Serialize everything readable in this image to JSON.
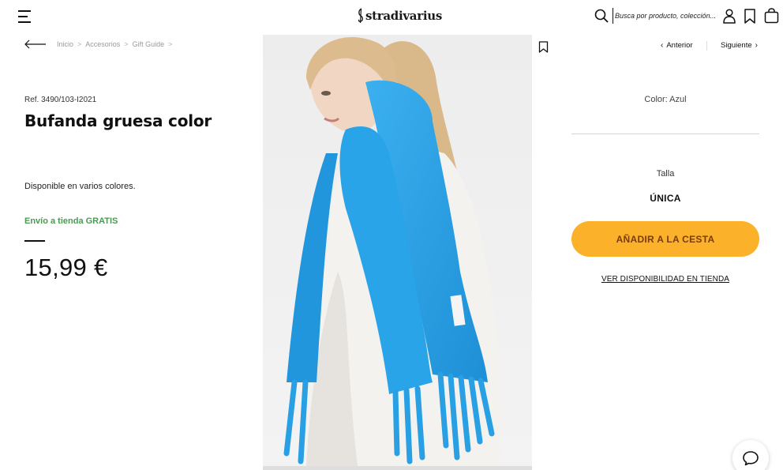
{
  "header": {
    "brand": "stradivarius",
    "search_placeholder": "Busca por producto, colección..."
  },
  "breadcrumb": {
    "items": [
      "Inicio",
      "Accesorios",
      "Gift Guide"
    ],
    "separator": ">"
  },
  "product": {
    "ref": "Ref. 3490/103-I2021",
    "name": "Bufanda gruesa color",
    "colors_note": "Disponible en varios colores.",
    "shipping": "Envío a tienda GRATIS",
    "price": "15,99 €",
    "color_label": "Color: Azul",
    "size_label": "Talla",
    "size_value": "ÚNICA"
  },
  "navigation": {
    "prev_label": "Anterior",
    "next_label": "Siguiente"
  },
  "actions": {
    "add_to_cart": "AÑADIR A LA CESTA",
    "store_availability": "VER DISPONIBILIDAD EN TIENDA"
  },
  "colors": {
    "accent_button": "#fbb12a",
    "button_text": "#7a3b10",
    "shipping_green": "#4a9a52",
    "scarf_blue": "#2aa4e8"
  },
  "icons": {
    "menu": "menu-icon",
    "search": "search-icon",
    "user": "user-icon",
    "wishlist": "bookmark-icon",
    "bag": "bag-icon",
    "back": "arrow-left-icon",
    "chat": "chat-icon"
  }
}
